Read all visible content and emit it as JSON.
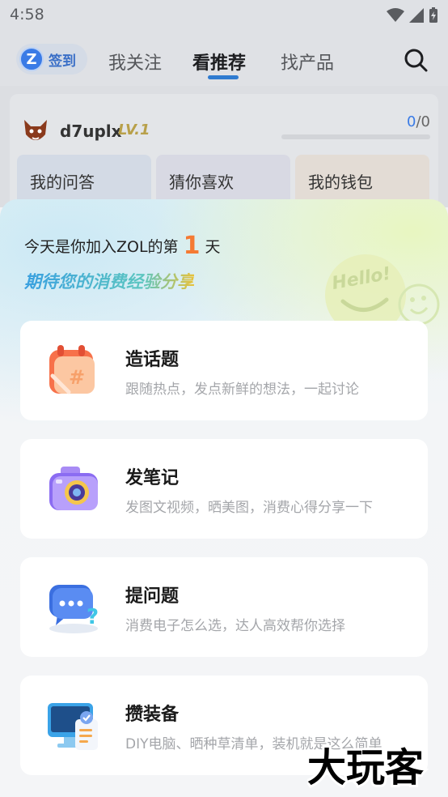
{
  "status_bar": {
    "time": "4:58"
  },
  "nav": {
    "checkin_label": "签到",
    "tabs": [
      {
        "label": "我关注",
        "active": false
      },
      {
        "label": "看推荐",
        "active": true
      },
      {
        "label": "找产品",
        "active": false
      }
    ]
  },
  "profile": {
    "username": "d7uplx",
    "level": "LV.1",
    "progress_current": "0",
    "progress_total": "/0",
    "quick_links": [
      "我的问答",
      "猜你喜欢",
      "我的钱包"
    ]
  },
  "sheet": {
    "join_prefix": "今天是你加入ZOL的第",
    "join_days": "1",
    "join_suffix": "天",
    "slogan": "期待您的消费经验分享",
    "hello_text": "Hello!",
    "options": [
      {
        "title": "造话题",
        "desc": "跟随热点，发点新鲜的想法，一起讨论",
        "icon": "calendar-hashtag-icon"
      },
      {
        "title": "发笔记",
        "desc": "发图文视频，晒美图，消费心得分享一下",
        "icon": "camera-icon"
      },
      {
        "title": "提问题",
        "desc": "消费电子怎么选，达人高效帮你选择",
        "icon": "question-chat-icon"
      },
      {
        "title": "攒装备",
        "desc": "DIY电脑、晒种草清单，装机就是这么简单",
        "icon": "monitor-checklist-icon"
      }
    ]
  },
  "watermark": "大玩客",
  "colors": {
    "accent": "#f57a33",
    "brand_blue": "#3a7be6"
  }
}
